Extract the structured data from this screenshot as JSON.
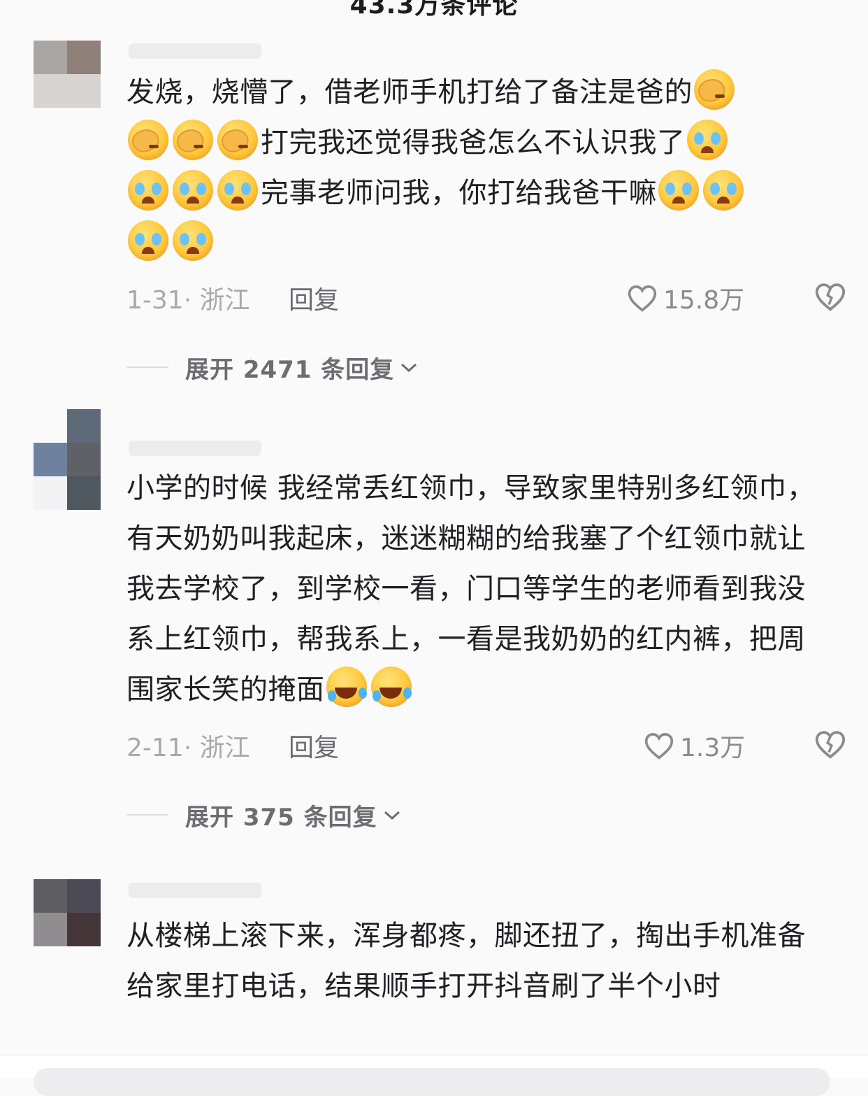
{
  "header": {
    "title": "43.3万条评论"
  },
  "comments": [
    {
      "text_parts": [
        "发烧，烧懵了，借老师手机打给了备注是爸的",
        "打完我还觉得我爸怎么不认识我了",
        "完事老师问我，你打给我爸干嘛"
      ],
      "emojis": [
        "facepalm",
        "crying"
      ],
      "date": "1-31",
      "location": "浙江",
      "date_location": "1-31· 浙江",
      "reply_label": "回复",
      "likes": "15.8万",
      "expand_label": "展开 2471 条回复"
    },
    {
      "text": "小学的时候 我经常丢红领巾，导致家里特别多红领巾，有天奶奶叫我起床，迷迷糊糊的给我塞了个红领巾就让我去学校了，到学校一看，门口等学生的老师看到我没系上红领巾，帮我系上，一看是我奶奶的红内裤，把周围家长笑的掩面",
      "emojis": [
        "rolling-on-floor-laughing"
      ],
      "date_location": "2-11· 浙江",
      "reply_label": "回复",
      "likes": "1.3万",
      "expand_label": "展开 375 条回复"
    },
    {
      "text": "从楼梯上滚下来，浑身都疼，脚还扭了，掏出手机准备给家里打电话，结果顺手打开抖音刷了半个小时"
    }
  ],
  "colors": {
    "background": "#fafafa",
    "text": "#1f1f24",
    "meta": "#a8a8ad",
    "reply": "#6a6a70"
  },
  "icons": [
    "heart-icon",
    "broken-heart-icon",
    "chevron-down-icon"
  ]
}
